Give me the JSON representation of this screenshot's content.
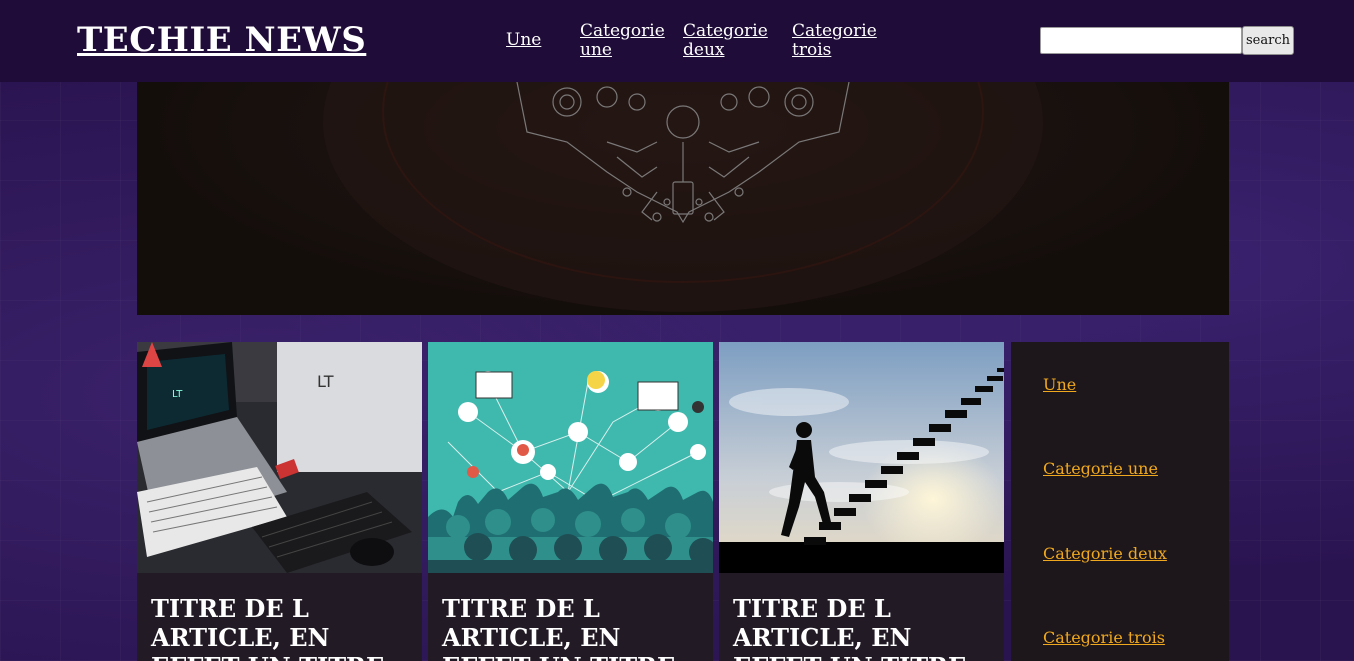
{
  "site": {
    "title": "TECHIE NEWS"
  },
  "nav": {
    "items": [
      {
        "label": "Une"
      },
      {
        "label": "Categorie une"
      },
      {
        "label": "Categorie deux"
      },
      {
        "label": "Categorie trois"
      }
    ]
  },
  "search": {
    "placeholder": "",
    "value": "",
    "button_label": "search"
  },
  "articles": [
    {
      "title": "TITRE DE L ARTICLE, EN EFFET UN TITRE",
      "image": "laptop-desk-photo"
    },
    {
      "title": "TITRE DE L ARTICLE, EN EFFET UN TITRE",
      "image": "network-crowd-illustration"
    },
    {
      "title": "TITRE DE L ARTICLE, EN EFFET UN TITRE",
      "image": "man-climbing-stairs-silhouette"
    }
  ],
  "sidebar": {
    "items": [
      {
        "label": "Une"
      },
      {
        "label": "Categorie une"
      },
      {
        "label": "Categorie deux"
      },
      {
        "label": "Categorie trois"
      }
    ]
  },
  "colors": {
    "header_bg": "#1f0c38",
    "page_bg": "#2a1450",
    "sidebar_link": "#f0a91e",
    "card_bg": "#221a25"
  }
}
